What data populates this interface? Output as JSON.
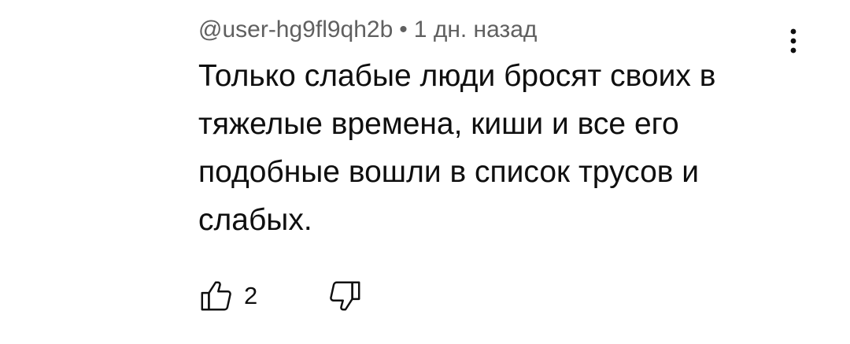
{
  "comment": {
    "author": "@user-hg9fl9qh2b",
    "separator": "•",
    "timestamp": "1 дн. назад",
    "text": "Только слабые люди бросят своих в тяжелые времена, киши и все его подобные вошли в список трусов и слабых.",
    "like_count": "2"
  },
  "icons": {
    "more": "more-vertical-icon",
    "like": "thumbs-up-icon",
    "dislike": "thumbs-down-icon"
  }
}
